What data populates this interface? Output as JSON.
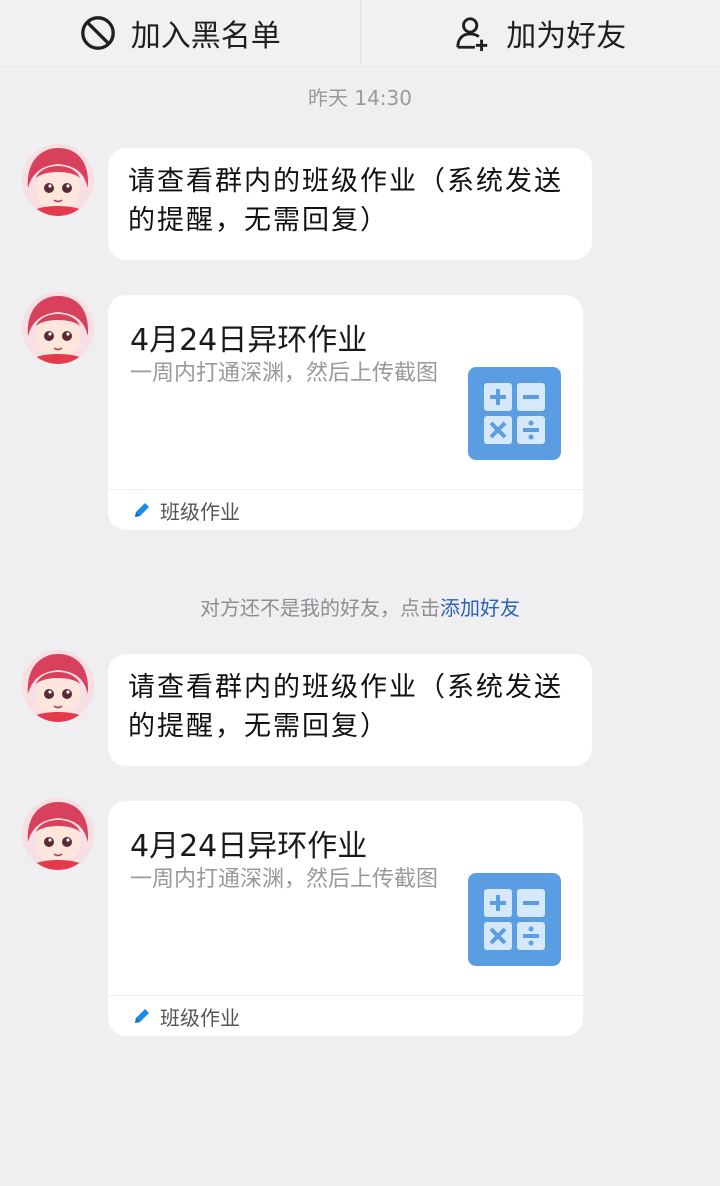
{
  "topbar": {
    "block_label": "加入黑名单",
    "block_icon": "block-icon",
    "add_friend_label": "加为好友",
    "add_friend_icon": "add-user-icon"
  },
  "timestamp": "昨天 14:30",
  "notice": {
    "text": "对方还不是我的好友，点击",
    "link": "添加好友"
  },
  "messages": [
    {
      "text_line1": "请查看群内的班级作业（系统发送",
      "text_line2": "的提醒，无需回复）",
      "card": {
        "title": "4月24日异环作业",
        "desc": "一周内打通深渊，然后上传截图",
        "icon": "calculator-icon",
        "footer_icon": "pencil-icon",
        "footer_label": "班级作业"
      }
    },
    {
      "text_line1": "请查看群内的班级作业（系统发送",
      "text_line2": "的提醒，无需回复）",
      "card": {
        "title": "4月24日异环作业",
        "desc": "一周内打通深渊，然后上传截图",
        "icon": "calculator-icon",
        "footer_icon": "pencil-icon",
        "footer_label": "班级作业"
      }
    }
  ],
  "colors": {
    "background": "#efeff1",
    "link": "#2a62b8",
    "card_icon_bg": "#5a9de3",
    "pencil": "#1e8be8"
  }
}
